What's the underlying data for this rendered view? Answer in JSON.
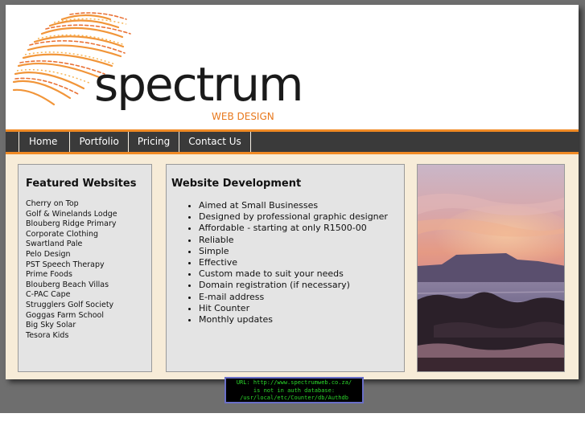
{
  "colors": {
    "accent": "#f08a24",
    "nav_bg": "#3a3a3a",
    "box_bg": "#e4e4e4",
    "page_bg": "#6e6e6e",
    "counter_text": "#2bd82b"
  },
  "header": {
    "logo_word": "spectrum",
    "logo_sub": "WEB DESIGN"
  },
  "nav": {
    "items": [
      {
        "label": "Home"
      },
      {
        "label": "Portfolio"
      },
      {
        "label": "Pricing"
      },
      {
        "label": "Contact Us"
      }
    ]
  },
  "featured": {
    "title": "Featured Websites",
    "sites": [
      "Cherry on Top",
      "Golf & Winelands Lodge",
      "Blouberg Ridge Primary",
      "Corporate Clothing",
      "Swartland Pale",
      "Pelo Design",
      "PST Speech Therapy",
      "Prime Foods",
      "Blouberg Beach Villas",
      "C-PAC Cape",
      "Strugglers Golf Society",
      "Goggas Farm School",
      "Big Sky Solar",
      "Tesora Kids"
    ]
  },
  "development": {
    "title": "Website Development",
    "points": [
      "Aimed at Small Businesses",
      "Designed by professional graphic designer",
      "Affordable - starting at only R1500-00",
      "Reliable",
      "Simple",
      "Effective",
      "Custom made to suit your needs",
      "Domain registration (if necessary)",
      "E-mail address",
      "Hit Counter",
      "Monthly updates"
    ]
  },
  "counter": {
    "lines": [
      "URL: http://www.spectrumweb.co.za/",
      "is not in auth database:",
      "/usr/local/etc/Counter/db/Authdb"
    ]
  }
}
